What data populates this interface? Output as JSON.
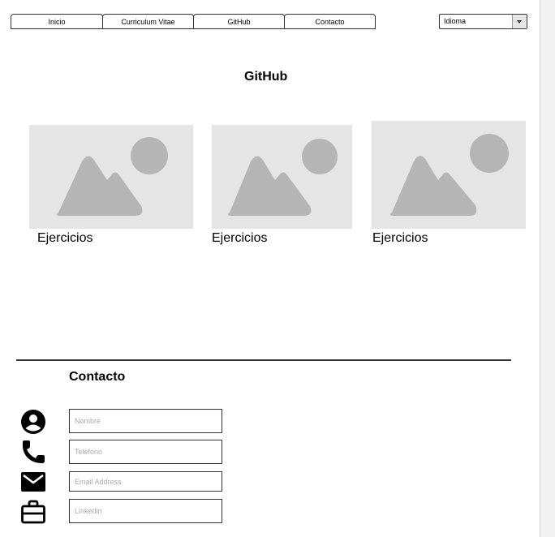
{
  "nav": {
    "tabs": [
      {
        "label": "Inicio"
      },
      {
        "label": "Curriculum Vitae"
      },
      {
        "label": "GitHub"
      },
      {
        "label": "Contacto"
      }
    ],
    "language_select": {
      "value": "Idioma"
    }
  },
  "github": {
    "title": "GitHub",
    "cards": [
      {
        "label": "Ejercicios"
      },
      {
        "label": "Ejercicios"
      },
      {
        "label": "Ejercicios"
      }
    ]
  },
  "contact": {
    "title": "Contacto",
    "fields": [
      {
        "icon": "user-circle-icon",
        "placeholder": "Nombre"
      },
      {
        "icon": "phone-icon",
        "placeholder": "Telefono"
      },
      {
        "icon": "envelope-icon",
        "placeholder": "Email Address"
      },
      {
        "icon": "briefcase-icon",
        "placeholder": "Linkedin"
      }
    ]
  },
  "colors": {
    "placeholder_bg": "#e5e5e5",
    "placeholder_fg": "#b5b5b5",
    "border": "#333333"
  }
}
